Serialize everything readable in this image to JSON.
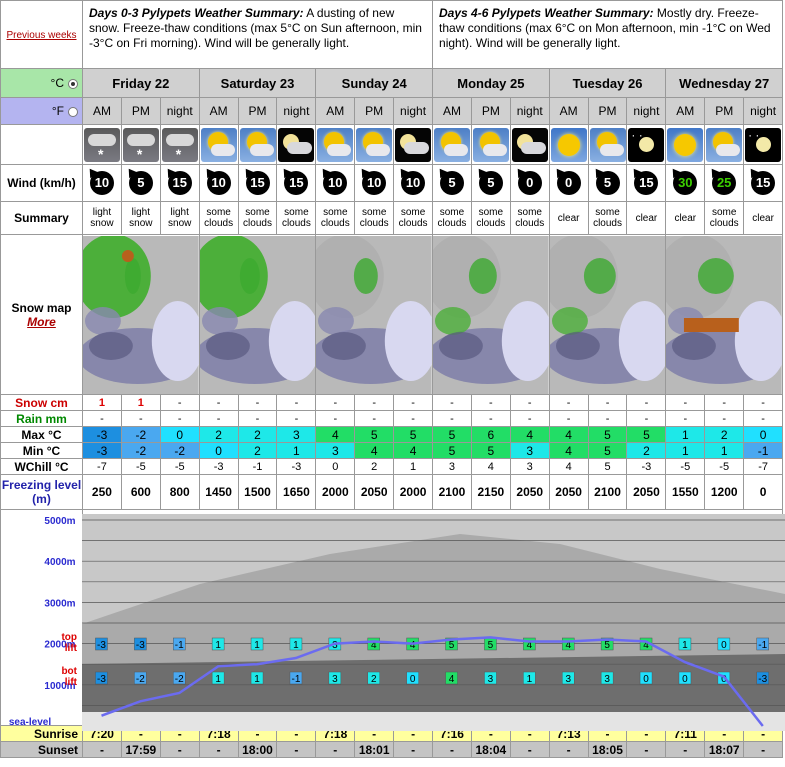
{
  "nav": {
    "previous_weeks": "Previous weeks"
  },
  "summaries": [
    {
      "heading": "Days 0-3 Pylypets Weather Summary:",
      "text": "A dusting of new snow. Freeze-thaw conditions (max 5°C on Sun afternoon, min -3°C on Fri morning). Wind will be generally light."
    },
    {
      "heading": "Days 4-6 Pylypets Weather Summary:",
      "text": "Mostly dry. Freeze-thaw conditions (max 6°C on Mon afternoon, min -1°C on Wed night). Wind will be generally light."
    }
  ],
  "units": {
    "celsius": "°C",
    "fahrenheit": "°F",
    "selected": "celsius"
  },
  "days": [
    "Friday 22",
    "Saturday 23",
    "Sunday 24",
    "Monday 25",
    "Tuesday 26",
    "Wednesday 27"
  ],
  "periods": [
    "AM",
    "PM",
    "night"
  ],
  "labels": {
    "wind": "Wind (km/h)",
    "summary": "Summary",
    "snow_map": "Snow map",
    "more": "More",
    "snow": "Snow cm",
    "rain": "Rain mm",
    "max": "Max °C",
    "min": "Min °C",
    "wchill": "WChill °C",
    "freezing": "Freezing level (m)",
    "sunrise": "Sunrise",
    "sunset": "Sunset"
  },
  "icons": [
    "snow",
    "snow",
    "snow",
    "cloudday",
    "cloudday",
    "cloudnight",
    "cloudday",
    "cloudday",
    "cloudnight",
    "cloudday",
    "cloudday",
    "cloudnight",
    "sunny",
    "cloudday",
    "clearnight",
    "sunny",
    "cloudday",
    "clearnight"
  ],
  "wind": [
    10,
    5,
    15,
    10,
    15,
    15,
    10,
    10,
    10,
    5,
    5,
    0,
    0,
    5,
    15,
    30,
    25,
    15
  ],
  "wind_colors": [
    "white",
    "white",
    "white",
    "white",
    "white",
    "white",
    "white",
    "white",
    "white",
    "white",
    "white",
    "white",
    "white",
    "white",
    "white",
    "green",
    "green",
    "white"
  ],
  "summary": [
    "light snow",
    "light snow",
    "light snow",
    "some clouds",
    "some clouds",
    "some clouds",
    "some clouds",
    "some clouds",
    "some clouds",
    "some clouds",
    "some clouds",
    "some clouds",
    "clear",
    "some clouds",
    "clear",
    "clear",
    "some clouds",
    "clear"
  ],
  "snow": [
    "1",
    "1",
    "-",
    "-",
    "-",
    "-",
    "-",
    "-",
    "-",
    "-",
    "-",
    "-",
    "-",
    "-",
    "-",
    "-",
    "-",
    "-"
  ],
  "rain": [
    "-",
    "-",
    "-",
    "-",
    "-",
    "-",
    "-",
    "-",
    "-",
    "-",
    "-",
    "-",
    "-",
    "-",
    "-",
    "-",
    "-",
    "-"
  ],
  "max": [
    -3,
    -2,
    0,
    2,
    2,
    3,
    4,
    5,
    5,
    5,
    6,
    4,
    4,
    5,
    5,
    1,
    2,
    0
  ],
  "min": [
    -3,
    -2,
    -2,
    0,
    2,
    1,
    3,
    4,
    4,
    5,
    5,
    3,
    4,
    5,
    2,
    1,
    1,
    -1
  ],
  "wchill": [
    -7,
    -5,
    -5,
    -3,
    -1,
    -3,
    0,
    2,
    1,
    3,
    4,
    3,
    4,
    5,
    -3,
    -5,
    -5,
    -7
  ],
  "freezing": [
    250,
    600,
    800,
    1450,
    1500,
    1650,
    2000,
    2050,
    2000,
    2100,
    2150,
    2050,
    2050,
    2100,
    2050,
    1550,
    1200,
    0
  ],
  "altitude": {
    "scale_labels": [
      "5000m",
      "4000m",
      "3000m",
      "2000m",
      "1000m",
      "sea-level"
    ],
    "top_lift_label": "top lift",
    "bot_lift_label": "bot lift",
    "top_lift_temps": [
      -3,
      -3,
      -1,
      1,
      1,
      1,
      3,
      4,
      4,
      5,
      5,
      4,
      4,
      5,
      4,
      1,
      0,
      -1
    ],
    "bot_lift_temps": [
      -3,
      -2,
      -2,
      1,
      1,
      -1,
      3,
      2,
      0,
      4,
      3,
      1,
      3,
      3,
      0,
      0,
      0,
      -3
    ]
  },
  "sunrise": [
    "7:20",
    "-",
    "-",
    "7:18",
    "-",
    "-",
    "7:18",
    "-",
    "-",
    "7:16",
    "-",
    "-",
    "7:13",
    "-",
    "-",
    "7:11",
    "-",
    "-"
  ],
  "sunset": [
    "-",
    "17:59",
    "-",
    "-",
    "18:00",
    "-",
    "-",
    "18:01",
    "-",
    "-",
    "18:04",
    "-",
    "-",
    "18:05",
    "-",
    "-",
    "18:07",
    "-"
  ],
  "colors": {
    "celsius_bg": "#a8e6a8",
    "fahrenheit_bg": "#b4b4f0",
    "sunrise_bg": "#ffff9e",
    "freezing_line": "#6b6bf0"
  }
}
